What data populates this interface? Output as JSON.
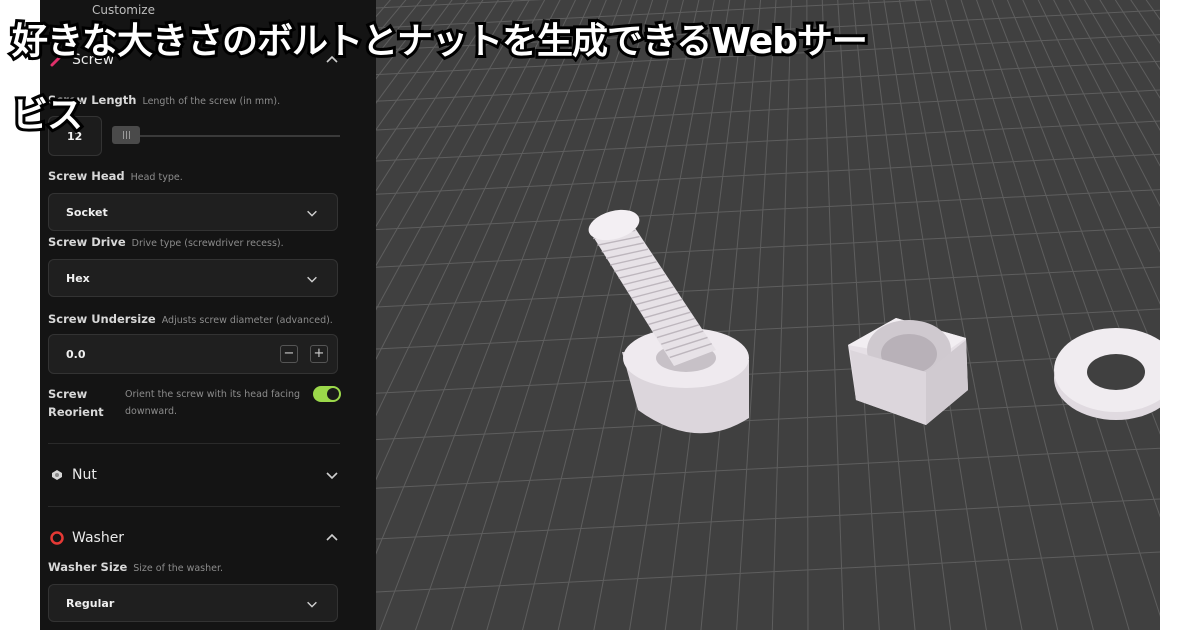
{
  "overlay": {
    "headline_line1": "好きな大きさのボルトとナットを生成できるWebサー",
    "headline_line2": "ビス"
  },
  "sidebar": {
    "panel_title_partial": "Customize",
    "screw": {
      "title": "Screw",
      "icon": "screw-icon",
      "accent_color": "#e0306a",
      "length": {
        "label": "Screw Length",
        "desc": "Length of the screw (in mm).",
        "value": "12"
      },
      "head": {
        "label": "Screw Head",
        "desc": "Head type.",
        "value": "Socket"
      },
      "drive": {
        "label": "Screw Drive",
        "desc": "Drive type (screwdriver recess).",
        "value": "Hex"
      },
      "undersize": {
        "label": "Screw Undersize",
        "desc": "Adjusts screw diameter (advanced).",
        "value": "0.0",
        "minus": "−",
        "plus": "+"
      },
      "reorient": {
        "label": "Screw Reorient",
        "desc": "Orient the screw with its head facing downward.",
        "enabled": true,
        "toggle_color": "#9bd84a"
      }
    },
    "nut": {
      "title": "Nut",
      "icon": "nut-icon"
    },
    "washer": {
      "title": "Washer",
      "icon": "washer-icon",
      "accent_color": "#e53935",
      "size": {
        "label": "Washer Size",
        "desc": "Size of the washer.",
        "value": "Regular"
      }
    }
  },
  "viewport": {
    "background": "#404040",
    "grid_color": "#5c5c5c",
    "part_color": "#ece7ec"
  }
}
